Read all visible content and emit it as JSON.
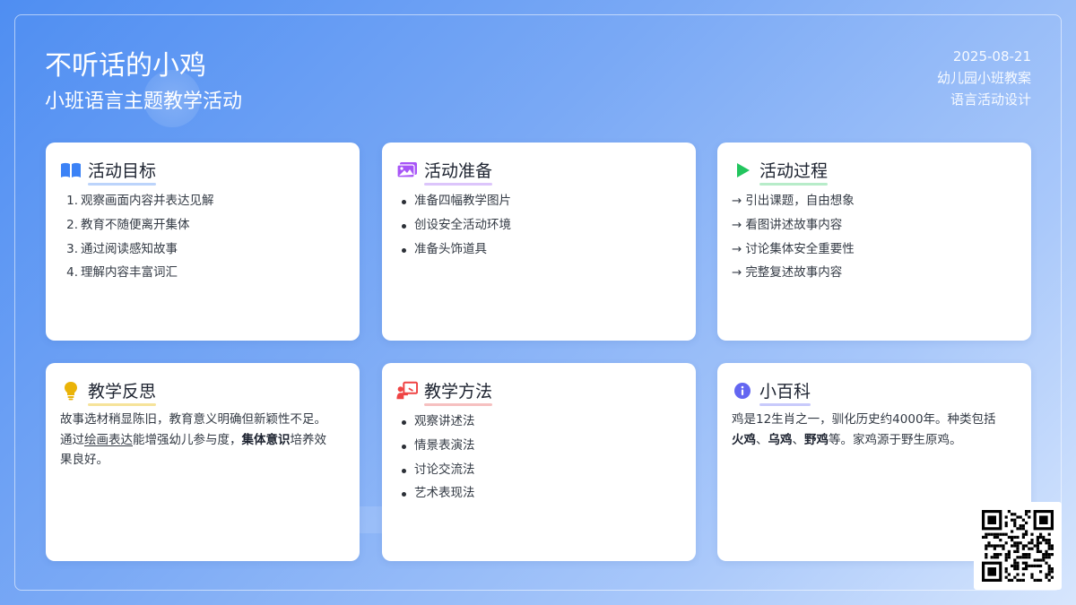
{
  "header": {
    "title": "不听话的小鸡",
    "subtitle": "小班语言主题教学活动",
    "date": "2025-08-21",
    "meta_line1": "幼儿园小班教案",
    "meta_line2": "语言活动设计"
  },
  "cards": {
    "goals": {
      "title": "活动目标",
      "icon": "book-icon",
      "accent": "#3b82f6",
      "items": [
        {
          "num": "1.",
          "text": "观察画面内容并表达见解"
        },
        {
          "num": "2.",
          "text": "教育不随便离开集体"
        },
        {
          "num": "3.",
          "text": "通过阅读感知故事"
        },
        {
          "num": "4.",
          "text": "理解内容丰富词汇"
        }
      ]
    },
    "prep": {
      "title": "活动准备",
      "icon": "images-icon",
      "accent": "#a855f7",
      "items": [
        "准备四幅教学图片",
        "创设安全活动环境",
        "准备头饰道具"
      ]
    },
    "process": {
      "title": "活动过程",
      "icon": "play-icon",
      "accent": "#22c55e",
      "arrow": "→",
      "items": [
        "引出课题，自由想象",
        "看图讲述故事内容",
        "讨论集体安全重要性",
        "完整复述故事内容"
      ]
    },
    "reflection": {
      "title": "教学反思",
      "icon": "lightbulb-icon",
      "accent": "#eab308",
      "text1": "故事选材稍显陈旧，教育意义明确但新颖性不足。",
      "text2a": "通过",
      "text2u": "绘画表达",
      "text2b": "能增强幼儿参与度，",
      "text2bold": "集体意识",
      "text2c": "培养效",
      "text3": "果良好。"
    },
    "methods": {
      "title": "教学方法",
      "icon": "teacher-board-icon",
      "accent": "#ef4444",
      "items": [
        "观察讲述法",
        "情景表演法",
        "讨论交流法",
        "艺术表现法"
      ]
    },
    "wiki": {
      "title": "小百科",
      "icon": "info-icon",
      "accent": "#6366f1",
      "text1": "鸡是12生肖之一，驯化历史约4000年。种类包括",
      "b1": "火鸡",
      "sep1": "、",
      "b2": "乌鸡",
      "sep2": "、",
      "b3": "野鸡",
      "text2": "等。家鸡源于野生原鸡。"
    }
  },
  "qr_code": {
    "icon": "qr-code-icon"
  }
}
